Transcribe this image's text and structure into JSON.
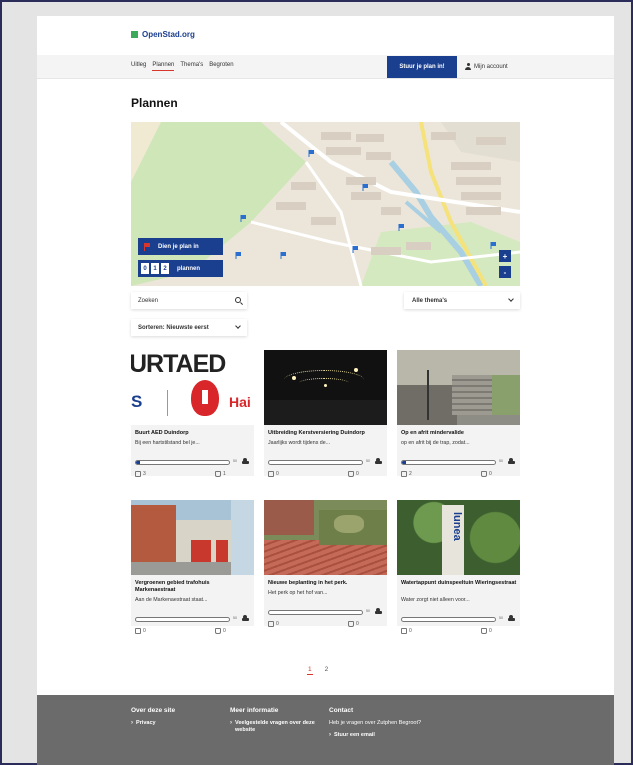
{
  "header": {
    "logo_text": "OpenStad.org",
    "nav": [
      "Uitleg",
      "Plannen",
      "Thema's",
      "Begroten"
    ],
    "active_nav": "Plannen",
    "cta_label": "Stuur je plan in!",
    "account_label": "Mijn account"
  },
  "page": {
    "title": "Plannen"
  },
  "map": {
    "submit_label": "Dien je plan in",
    "count_digits": [
      "0",
      "1",
      "2"
    ],
    "count_label": "plannen",
    "zoom_in": "+",
    "zoom_out": "-"
  },
  "filters": {
    "search_placeholder": "Zoeken",
    "themes_label": "Alle thema's",
    "sort_label": "Sorteren: Nieuwste eerst"
  },
  "cards": [
    {
      "title": "Buurt AED Duindorp",
      "desc": "Bij een hartstilstand bel je...",
      "progress": 0.03,
      "goal": "50",
      "up": "3",
      "down": "1",
      "thumb_text": "URTAED",
      "thumb_sub_left": "S",
      "thumb_sub_right": "Hai"
    },
    {
      "title": "Uitbreiding Kerstversiering Duindorp",
      "desc": "Jaarlijks wordt tijdens de...",
      "progress": 0.0,
      "goal": "50",
      "up": "0",
      "down": "0"
    },
    {
      "title": "Op en afrit mindervalide",
      "desc": "op en afrit bij de trap, zodat...",
      "progress": 0.03,
      "goal": "50",
      "up": "2",
      "down": "0"
    },
    {
      "title": "Vergroenen gebied trafohuis Markenaestraat",
      "desc": "Aan de Markenaestraat staat...",
      "progress": 0.0,
      "goal": "50",
      "up": "0",
      "down": "0"
    },
    {
      "title": "Nieuwe beplanting in het perk.",
      "desc": "Het perk op het hof van...",
      "progress": 0.0,
      "goal": "50",
      "up": "0",
      "down": "0"
    },
    {
      "title": "Watertappunt duinspeeltuin Wieringsestraat",
      "desc": "Water zorgt niet alleen voor...",
      "progress": 0.0,
      "goal": "50",
      "up": "0",
      "down": "0",
      "thumb_text": "lunea"
    }
  ],
  "pagination": {
    "pages": [
      "1",
      "2"
    ],
    "current": "1"
  },
  "footer": {
    "col1_title": "Over deze site",
    "col1_link": "Privacy",
    "col2_title": "Meer informatie",
    "col2_link": "Veelgestelde vragen over deze website",
    "col3_title": "Contact",
    "col3_text": "Heb je vragen over Zutphen Begroot?",
    "col3_link": "Stuur een email"
  },
  "colors": {
    "brand": "#1b3f8f",
    "accent": "#d8362a",
    "logo_green": "#3caa5a",
    "footer": "#6b6b6b"
  }
}
